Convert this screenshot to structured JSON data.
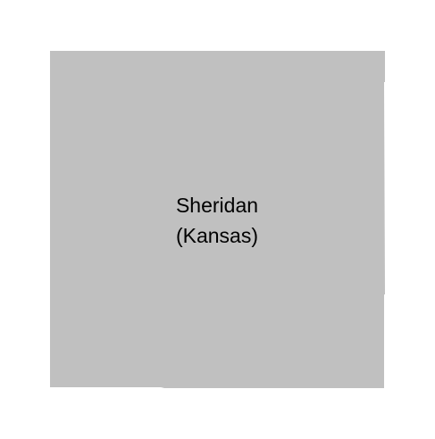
{
  "map": {
    "region_name": "Sheridan",
    "region_state": "(Kansas)",
    "fill_color": "#c0c0c0",
    "background_color": "#ffffff",
    "text_color": "#000000"
  }
}
